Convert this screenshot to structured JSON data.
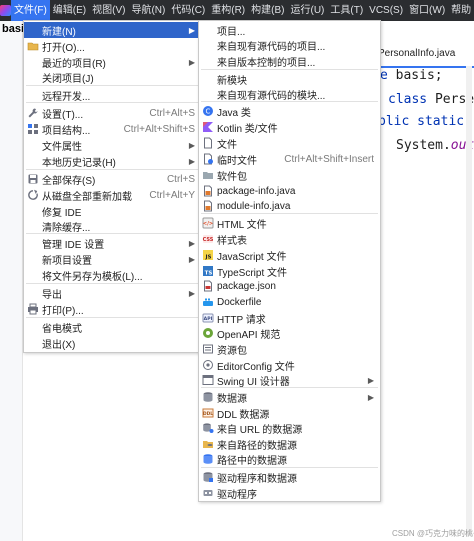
{
  "menubar": {
    "items": [
      {
        "label": "文件(F)",
        "active": true
      },
      {
        "label": "编辑(E)"
      },
      {
        "label": "视图(V)"
      },
      {
        "label": "导航(N)"
      },
      {
        "label": "代码(C)"
      },
      {
        "label": "重构(R)"
      },
      {
        "label": "构建(B)"
      },
      {
        "label": "运行(U)"
      },
      {
        "label": "工具(T)"
      },
      {
        "label": "VCS(S)"
      },
      {
        "label": "窗口(W)"
      },
      {
        "label": "帮助"
      }
    ]
  },
  "editor": {
    "project_tab": "basi",
    "file_tab": "PersonalInfo.java",
    "code": {
      "line1_kw": "e",
      "line1_rest": " basis;",
      "line2_kw": "class",
      "line2_rest": " Perse",
      "line3_kw": "blic static",
      "line4_plain": "System.",
      "line4_field": "out"
    }
  },
  "file_menu": {
    "items": [
      {
        "label": "新建(N)",
        "submenu": true,
        "icon": "none",
        "selected": true
      },
      {
        "label": "打开(O)...",
        "icon": "folder-icon"
      },
      {
        "label": "最近的项目(R)",
        "submenu": true
      },
      {
        "label": "关闭项目(J)"
      },
      {
        "label": "远程开发..."
      },
      {
        "label": "设置(T)...",
        "shortcut": "Ctrl+Alt+S",
        "icon": "wrench-icon"
      },
      {
        "label": "项目结构...",
        "shortcut": "Ctrl+Alt+Shift+S",
        "icon": "project-structure-icon"
      },
      {
        "label": "文件属性",
        "submenu": true
      },
      {
        "label": "本地历史记录(H)",
        "submenu": true
      },
      {
        "label": "全部保存(S)",
        "shortcut": "Ctrl+S",
        "icon": "save-icon"
      },
      {
        "label": "从磁盘全部重新加载",
        "shortcut": "Ctrl+Alt+Y",
        "icon": "reload-icon"
      },
      {
        "label": "修复 IDE"
      },
      {
        "label": "清除缓存..."
      },
      {
        "label": "管理 IDE 设置",
        "submenu": true
      },
      {
        "label": "新项目设置",
        "submenu": true
      },
      {
        "label": "将文件另存为模板(L)..."
      },
      {
        "label": "导出",
        "submenu": true
      },
      {
        "label": "打印(P)...",
        "icon": "print-icon"
      },
      {
        "label": "省电模式"
      },
      {
        "label": "退出(X)"
      }
    ]
  },
  "new_menu": {
    "items": [
      {
        "label": "项目..."
      },
      {
        "label": "来自现有源代码的项目..."
      },
      {
        "label": "来自版本控制的项目..."
      },
      {
        "label": "新模块"
      },
      {
        "label": "来自现有源代码的模块..."
      },
      {
        "label": "Java 类",
        "icon": "java-class-icon"
      },
      {
        "label": "Kotlin 类/文件",
        "icon": "kotlin-icon"
      },
      {
        "label": "文件",
        "icon": "file-icon"
      },
      {
        "label": "临时文件",
        "shortcut": "Ctrl+Alt+Shift+Insert",
        "icon": "scratch-file-icon"
      },
      {
        "label": "软件包",
        "icon": "package-icon"
      },
      {
        "label": "package-info.java",
        "icon": "java-file-icon"
      },
      {
        "label": "module-info.java",
        "icon": "java-file-icon"
      },
      {
        "label": "HTML 文件",
        "icon": "html-icon"
      },
      {
        "label": "样式表",
        "icon": "css-icon"
      },
      {
        "label": "JavaScript 文件",
        "icon": "js-icon"
      },
      {
        "label": "TypeScript 文件",
        "icon": "ts-icon"
      },
      {
        "label": "package.json",
        "icon": "npm-icon"
      },
      {
        "label": "Dockerfile",
        "icon": "docker-icon"
      },
      {
        "label": "HTTP 请求",
        "icon": "api-icon"
      },
      {
        "label": "OpenAPI 规范",
        "icon": "openapi-icon"
      },
      {
        "label": "资源包",
        "icon": "resource-bundle-icon"
      },
      {
        "label": "EditorConfig 文件",
        "icon": "editorconfig-icon"
      },
      {
        "label": "Swing UI 设计器",
        "submenu": true,
        "icon": "form-icon"
      },
      {
        "label": "数据源",
        "submenu": true,
        "icon": "datasource-icon"
      },
      {
        "label": "DDL 数据源",
        "icon": "ddl-icon"
      },
      {
        "label": "来自 URL 的数据源",
        "icon": "datasource-url-icon"
      },
      {
        "label": "来自路径的数据源",
        "icon": "datasource-path-icon"
      },
      {
        "label": "路径中的数据源",
        "icon": "datasource-in-path-icon"
      },
      {
        "label": "驱动程序和数据源",
        "icon": "driver-datasource-icon"
      },
      {
        "label": "驱动程序",
        "icon": "driver-icon"
      }
    ]
  },
  "watermark": "CSDN @巧克力味的桃子",
  "colors": {
    "menubar_bg": "#2b2d30",
    "selection": "#2f65ca",
    "accent": "#3574f0"
  }
}
